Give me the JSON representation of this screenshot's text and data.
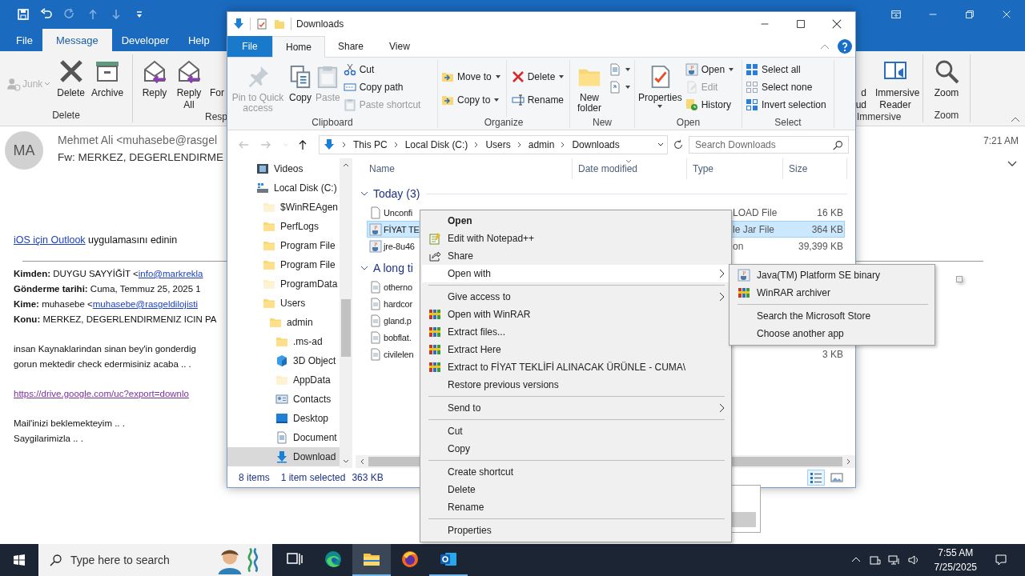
{
  "outlook": {
    "quick_access": [
      {
        "kind": "save",
        "disabled": false
      },
      {
        "kind": "undo",
        "disabled": false
      },
      {
        "kind": "redo",
        "disabled": true
      },
      {
        "kind": "up",
        "disabled": true
      },
      {
        "kind": "down",
        "disabled": true
      },
      {
        "kind": "customize",
        "disabled": false
      }
    ],
    "tabs": [
      {
        "label": "File",
        "selected": false
      },
      {
        "label": "Message",
        "selected": true
      },
      {
        "label": "Developer",
        "selected": false
      },
      {
        "label": "Help",
        "selected": false
      }
    ],
    "ribbon_left": [
      {
        "label": "Delete",
        "buttons": [
          {
            "label": "Junk",
            "kind": "small",
            "disabled": true,
            "dropdown": true
          },
          {
            "label": "Delete",
            "kind": "large",
            "disabled": false,
            "dropdown": false
          },
          {
            "label": "Archive",
            "kind": "large",
            "disabled": false,
            "dropdown": false
          }
        ]
      },
      {
        "label": "Resp",
        "buttons": [
          {
            "label": "Reply",
            "kind": "large",
            "disabled": false,
            "dropdown": false
          },
          {
            "label": "Reply All",
            "kind": "large",
            "disabled": false,
            "dropdown": false
          },
          {
            "label": "For",
            "kind": "partial",
            "disabled": false,
            "dropdown": false
          }
        ]
      }
    ],
    "ribbon_right": [
      {
        "label": "Immersive",
        "buttons": [
          {
            "label": "d ud",
            "kind": "partial",
            "disabled": false,
            "dropdown": false
          },
          {
            "label": "Immersive Reader",
            "kind": "large",
            "disabled": false,
            "dropdown": false
          }
        ]
      },
      {
        "label": "Zoom",
        "buttons": [
          {
            "label": "Zoom",
            "kind": "large",
            "disabled": false,
            "dropdown": false
          }
        ]
      }
    ],
    "message": {
      "avatar": "MA",
      "from": "Mehmet Ali <muhasebe@rasgel",
      "subject": "Fw: MERKEZ, DEGERLENDIRME",
      "time": "7:21 AM"
    },
    "body": [
      {
        "kind": "promo",
        "link": "iOS için Outlook",
        "text": "uygulamasını edinin"
      },
      {
        "kind": "rule"
      },
      {
        "kind": "field",
        "label": "Kimden:",
        "text": "DUYGU SAYYİĞİT <",
        "link": "info@markrekla"
      },
      {
        "kind": "field",
        "label": "Gönderme tarihi:",
        "text": "Cuma, Temmuz 25, 2025 1"
      },
      {
        "kind": "field",
        "label": "Kime:",
        "text": "muhasebe <",
        "link": "muhasebe@rasgeldilojisti"
      },
      {
        "kind": "field",
        "label": "Konu:",
        "text": "MERKEZ, DEGERLENDIRMENIZ ICIN PA"
      },
      {
        "kind": "paragraph",
        "lines": [
          "insan Kaynaklarindan sinan bey'in gonderdig",
          "gorun mektedir check edermisiniz acaba .. ."
        ]
      },
      {
        "kind": "url",
        "link": "https://drive.google.com/uc?export=downlo"
      },
      {
        "kind": "paragraph",
        "lines": [
          "Mail'inizi beklemekteyim .. .",
          "Saygilarimizla .. ."
        ]
      }
    ]
  },
  "explorer": {
    "title": "Downloads",
    "tabs": [
      {
        "label": "File",
        "kind": "menu",
        "selected": false
      },
      {
        "label": "Home",
        "kind": "tab",
        "selected": true
      },
      {
        "label": "Share",
        "kind": "tab",
        "selected": false
      },
      {
        "label": "View",
        "kind": "tab",
        "selected": false
      }
    ],
    "ribbon": [
      {
        "label": "Clipboard",
        "columns": [
          {
            "kind": "large",
            "label": "Pin to Quick access",
            "disabled": true,
            "dropdown": false
          },
          {
            "kind": "large",
            "label": "Copy",
            "disabled": false,
            "dropdown": false
          },
          {
            "kind": "large",
            "label": "Paste",
            "disabled": true,
            "dropdown": false
          },
          {
            "kind": "stack",
            "buttons": [
              {
                "label": "Cut",
                "disabled": false,
                "dropdown": false
              },
              {
                "label": "Copy path",
                "disabled": false,
                "dropdown": false
              },
              {
                "label": "Paste shortcut",
                "disabled": true,
                "dropdown": false
              }
            ]
          }
        ]
      },
      {
        "label": "Organize",
        "columns": [
          {
            "kind": "stack",
            "buttons": [
              {
                "label": "Move to",
                "disabled": false,
                "dropdown": true
              },
              {
                "label": "Copy to",
                "disabled": false,
                "dropdown": true
              }
            ]
          },
          {
            "kind": "stack",
            "buttons": [
              {
                "label": "Delete",
                "disabled": false,
                "dropdown": true
              },
              {
                "label": "Rename",
                "disabled": false,
                "dropdown": false
              }
            ]
          }
        ]
      },
      {
        "label": "New",
        "columns": [
          {
            "kind": "large",
            "label": "New folder",
            "disabled": false,
            "dropdown": false
          },
          {
            "kind": "stack",
            "buttons": [
              {
                "disabled": false,
                "dropdown": true
              },
              {
                "disabled": false,
                "dropdown": true
              }
            ]
          }
        ]
      },
      {
        "label": "Open",
        "columns": [
          {
            "kind": "large",
            "label": "Properties",
            "disabled": false,
            "dropdown": true
          },
          {
            "kind": "stack",
            "buttons": [
              {
                "label": "Open",
                "disabled": false,
                "dropdown": true
              },
              {
                "label": "Edit",
                "disabled": true,
                "dropdown": false
              },
              {
                "label": "History",
                "disabled": false,
                "dropdown": false
              }
            ]
          }
        ]
      },
      {
        "label": "Select",
        "columns": [
          {
            "kind": "stack",
            "buttons": [
              {
                "label": "Select all",
                "disabled": false,
                "dropdown": false
              },
              {
                "label": "Select none",
                "disabled": false,
                "dropdown": false
              },
              {
                "label": "Invert selection",
                "disabled": false,
                "dropdown": false
              }
            ]
          }
        ]
      }
    ],
    "nav_buttons": [
      {
        "kind": "back",
        "disabled": true
      },
      {
        "kind": "forward",
        "disabled": true
      },
      {
        "kind": "recent",
        "disabled": true
      },
      {
        "kind": "up",
        "disabled": false
      }
    ],
    "address": [
      "This PC",
      "Local Disk (C:)",
      "Users",
      "admin",
      "Downloads"
    ],
    "search": {
      "placeholder": "Search Downloads"
    },
    "tree": [
      {
        "label": "Videos",
        "kind": "videos",
        "selected": false
      },
      {
        "label": "Local Disk (C:)",
        "kind": "drive",
        "selected": false,
        "children": [
          {
            "label": "$WinREAgen",
            "kind": "hidden-folder",
            "selected": false
          },
          {
            "label": "PerfLogs",
            "kind": "folder",
            "selected": false
          },
          {
            "label": "Program File",
            "kind": "folder",
            "selected": false
          },
          {
            "label": "Program File",
            "kind": "folder",
            "selected": false
          },
          {
            "label": "ProgramData",
            "kind": "hidden-folder",
            "selected": false
          },
          {
            "label": "Users",
            "kind": "folder",
            "selected": false,
            "children": [
              {
                "label": "admin",
                "kind": "folder",
                "selected": false,
                "children": [
                  {
                    "label": ".ms-ad",
                    "kind": "folder",
                    "selected": false
                  },
                  {
                    "label": "3D Object",
                    "kind": "objects",
                    "selected": false
                  },
                  {
                    "label": "AppData",
                    "kind": "hidden-folder",
                    "selected": false
                  },
                  {
                    "label": "Contacts",
                    "kind": "contacts",
                    "selected": false
                  },
                  {
                    "label": "Desktop",
                    "kind": "desktop",
                    "selected": false
                  },
                  {
                    "label": "Document",
                    "kind": "documents",
                    "selected": false
                  },
                  {
                    "label": "Download",
                    "kind": "downloads",
                    "selected": true
                  }
                ]
              }
            ]
          }
        ]
      }
    ],
    "columns": [
      "Name",
      "Date modified",
      "Type",
      "Size"
    ],
    "groups": [
      {
        "label": "Today (3)",
        "expanded": true,
        "files": [
          {
            "name": "Unconfi",
            "kind": "blank",
            "type": "LOAD File",
            "size": "16 KB",
            "selected": false
          },
          {
            "name": "FİYAT TE",
            "kind": "jar",
            "type": "le Jar File",
            "size": "364 KB",
            "selected": true
          },
          {
            "name": "jre-8u46",
            "kind": "jar",
            "type": "on",
            "size": "39,399 KB",
            "selected": false
          }
        ]
      },
      {
        "label": "A long ti",
        "expanded": true,
        "files": [
          {
            "name": "otherno",
            "kind": "doc",
            "selected": false
          },
          {
            "name": "hardcor",
            "kind": "doc",
            "selected": false
          },
          {
            "name": "gland.p",
            "kind": "doc",
            "selected": false
          },
          {
            "name": "bobflat.",
            "kind": "doc",
            "selected": false
          },
          {
            "name": "civilelen",
            "kind": "doc",
            "size": "3 KB",
            "selected": false
          }
        ]
      }
    ],
    "status": {
      "count": "8 items",
      "selection": "1 item selected",
      "size": "363 KB"
    },
    "views": [
      {
        "kind": "details",
        "selected": true
      },
      {
        "kind": "large-icons",
        "selected": false
      }
    ]
  },
  "context_menu": [
    [
      {
        "label": "Open",
        "kind": "plain",
        "default": true,
        "submenu": false,
        "selected": false
      },
      {
        "label": "Edit with Notepad++",
        "kind": "notepad",
        "default": false,
        "submenu": false,
        "selected": false
      },
      {
        "label": "Share",
        "kind": "share",
        "default": false,
        "submenu": false,
        "selected": false
      },
      {
        "label": "Open with",
        "kind": "plain",
        "default": false,
        "submenu": true,
        "selected": true
      }
    ],
    [
      {
        "label": "Give access to",
        "kind": "plain",
        "default": false,
        "submenu": true,
        "selected": false
      },
      {
        "label": "Open with WinRAR",
        "kind": "winrar",
        "default": false,
        "submenu": false,
        "selected": false
      },
      {
        "label": "Extract files...",
        "kind": "winrar",
        "default": false,
        "submenu": false,
        "selected": false
      },
      {
        "label": "Extract Here",
        "kind": "winrar",
        "default": false,
        "submenu": false,
        "selected": false
      },
      {
        "label": "Extract to FİYAT TEKLİFİ ALINACAK ÜRÜNLE - CUMA\\",
        "kind": "winrar",
        "default": false,
        "submenu": false,
        "selected": false
      },
      {
        "label": "Restore previous versions",
        "kind": "plain",
        "default": false,
        "submenu": false,
        "selected": false
      }
    ],
    [
      {
        "label": "Send to",
        "kind": "plain",
        "default": false,
        "submenu": true,
        "selected": false
      }
    ],
    [
      {
        "label": "Cut",
        "kind": "plain",
        "default": false,
        "submenu": false,
        "selected": false
      },
      {
        "label": "Copy",
        "kind": "plain",
        "default": false,
        "submenu": false,
        "selected": false
      }
    ],
    [
      {
        "label": "Create shortcut",
        "kind": "plain",
        "default": false,
        "submenu": false,
        "selected": false
      },
      {
        "label": "Delete",
        "kind": "plain",
        "default": false,
        "submenu": false,
        "selected": false
      },
      {
        "label": "Rename",
        "kind": "plain",
        "default": false,
        "submenu": false,
        "selected": false
      }
    ],
    [
      {
        "label": "Properties",
        "kind": "plain",
        "default": false,
        "submenu": false,
        "selected": false
      }
    ]
  ],
  "submenu": [
    [
      {
        "label": "Java(TM) Platform SE binary",
        "kind": "java"
      },
      {
        "label": "WinRAR archiver",
        "kind": "winrar"
      }
    ],
    [
      {
        "label": "Search the Microsoft Store",
        "kind": "plain"
      },
      {
        "label": "Choose another app",
        "kind": "plain"
      }
    ]
  ],
  "taskbar": {
    "search": {
      "placeholder": "Type here to search"
    },
    "apps": [
      {
        "kind": "task-view",
        "running": false,
        "focused": false
      },
      {
        "kind": "edge",
        "running": false,
        "focused": false
      },
      {
        "kind": "explorer",
        "running": true,
        "focused": true
      },
      {
        "kind": "firefox",
        "running": false,
        "focused": false
      },
      {
        "kind": "outlook",
        "running": true,
        "focused": false
      }
    ],
    "time": "7:55 AM",
    "date": "7/25/2025"
  }
}
